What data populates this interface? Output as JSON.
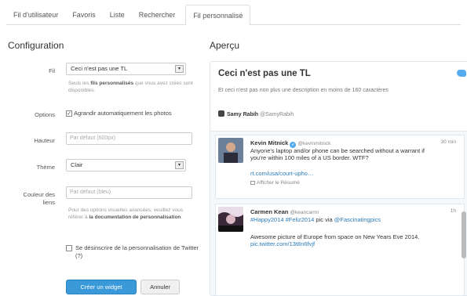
{
  "tabs": [
    "Fil d'utilisateur",
    "Favoris",
    "Liste",
    "Rechercher",
    "Fil personnalisé"
  ],
  "config": {
    "title": "Configuration",
    "fil_label": "Fil",
    "fil_value": "Ceci n'est pas une TL",
    "fil_help_pre": "Seuls les ",
    "fil_help_bold": "fils personnalisés",
    "fil_help_post": " que vous avez créés sont disponibles.",
    "options_label": "Options",
    "options_check": "Agrandir automatiquement les photos",
    "hauteur_label": "Hauteur",
    "hauteur_placeholder": "Par défaut (600px)",
    "theme_label": "Thème",
    "theme_value": "Clair",
    "couleur_label_1": "Couleur des",
    "couleur_label_2": "liens",
    "couleur_placeholder": "Par défaut (bleu)",
    "couleur_help_pre": "Pour des options visuelles avancées, veuillez vous référer à ",
    "couleur_help_link": "la documentation de personnalisation",
    "couleur_help_post": ".",
    "optout_label": "Se désinscrire de la personnalisation de Twitter (?)",
    "create_button": "Créer un widget",
    "cancel_button": "Annuler"
  },
  "preview": {
    "title": "Aperçu",
    "widget_title": "Ceci n'est pas une TL",
    "widget_desc": "Et ceci n'est pas non plus une description en moins de 160 caractères",
    "author_name": "Samy Rabih",
    "author_handle": "@SamyRabih",
    "tweets": [
      {
        "name": "Kevin Mitnick",
        "handle": "@kevinmitnick",
        "time": "30 min",
        "text": "Anyone's laptop and/or phone can be searched without a warrant if you're within 100 miles of a US border. WTF?",
        "link": "rt.com/usa/court-upho…",
        "summary": "Afficher le Résumé"
      },
      {
        "name": "Carmen Kean",
        "handle": "@keancarmi",
        "time": "1h",
        "text_pre": "#Happy2014 #Feliz2014",
        "text_mid": " pic via ",
        "text_via": "@Fascinatingpics",
        "text2": "Awesome picture of Europe from space on New Years Eve 2014.",
        "link2": "pic.twitter.com/13t8n6fvjf"
      }
    ]
  }
}
